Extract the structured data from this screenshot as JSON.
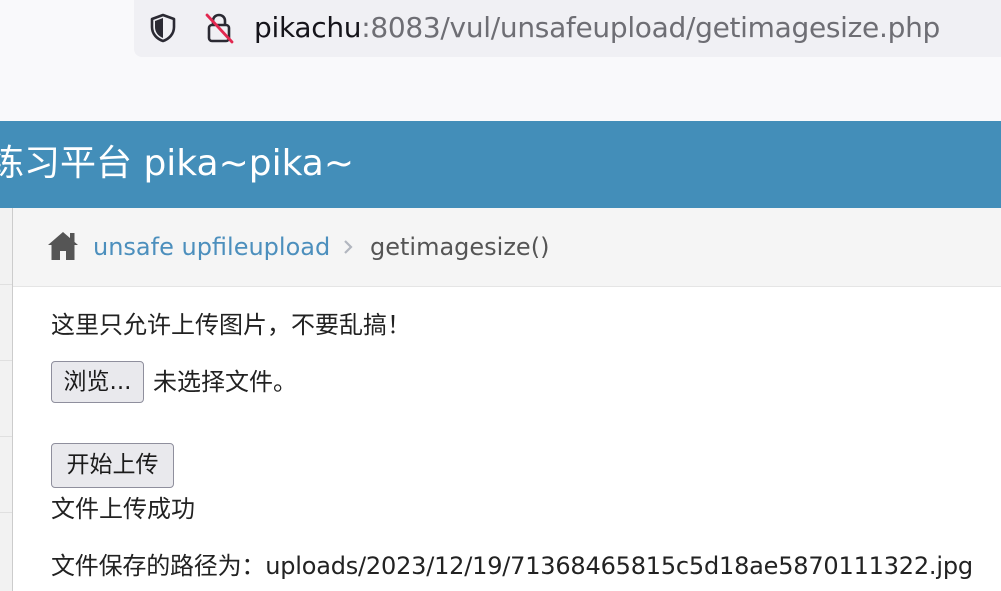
{
  "browser": {
    "url_host": "pikachu",
    "url_rest": ":8083/vul/unsafeupload/getimagesize.php"
  },
  "site": {
    "title": "练习平台 pika~pika~",
    "header_color": "#438eb9"
  },
  "breadcrumb": {
    "home_icon": "home-icon",
    "parent_label": "unsafe upfileupload",
    "current_label": "getimagesize()"
  },
  "main": {
    "hint": "这里只允许上传图片，不要乱搞！",
    "browse_label": "浏览...",
    "file_status": "未选择文件。",
    "upload_label": "开始上传",
    "result_message": "文件上传成功",
    "path_label": "文件保存的路径为：",
    "path_value": "uploads/2023/12/19/71368465815c5d18ae5870111322.jpg"
  }
}
